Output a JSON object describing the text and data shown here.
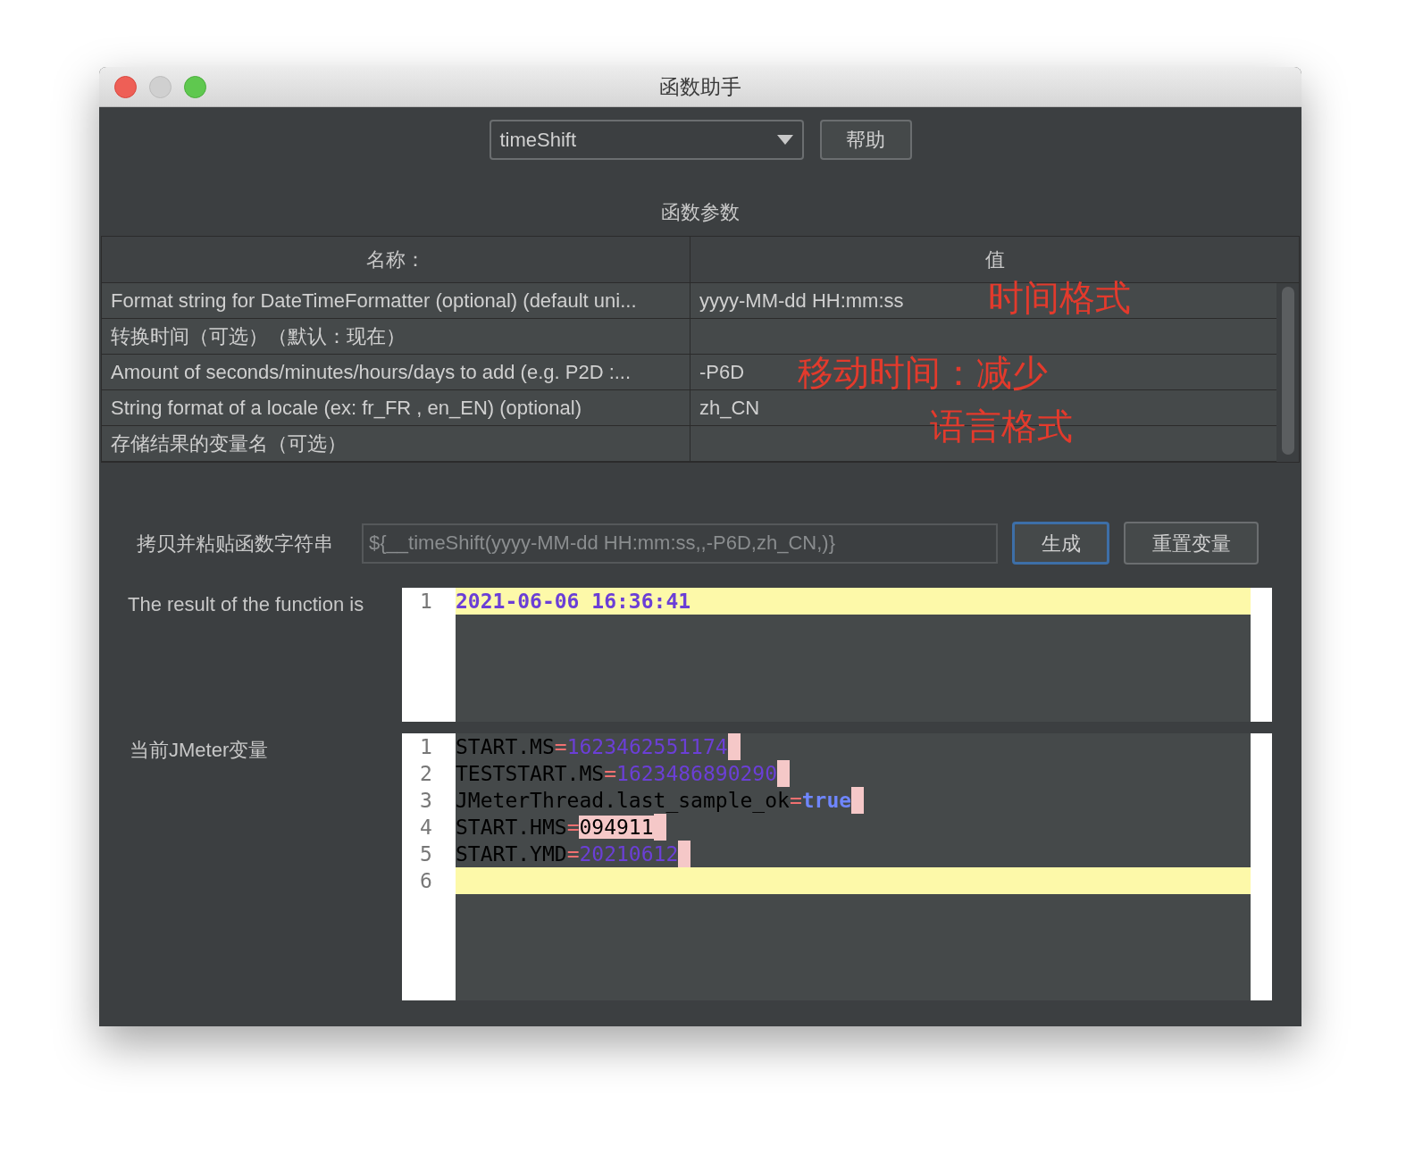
{
  "window": {
    "title": "函数助手"
  },
  "function_select": {
    "value": "timeShift"
  },
  "help_button": "帮助",
  "params_title": "函数参数",
  "table": {
    "columns": [
      "名称：",
      "值"
    ],
    "rows": [
      {
        "name": "Format string for DateTimeFormatter (optional) (default uni...",
        "value": "yyyy-MM-dd HH:mm:ss"
      },
      {
        "name": "转换时间（可选）（默认：现在）",
        "value": ""
      },
      {
        "name": "Amount of seconds/minutes/hours/days to add (e.g. P2D :...",
        "value": "-P6D"
      },
      {
        "name": "String format of a locale (ex: fr_FR , en_EN) (optional)",
        "value": "zh_CN"
      },
      {
        "name": "存储结果的变量名（可选）",
        "value": ""
      }
    ]
  },
  "annotations": [
    "时间格式",
    "移动时间：减少",
    "语言格式"
  ],
  "copy_label": "拷贝并粘贴函数字符串",
  "function_string": "${__timeShift(yyyy-MM-dd HH:mm:ss,,-P6D,zh_CN,)}",
  "buttons": [
    {
      "label": "生成",
      "selected": true
    },
    {
      "label": "重置变量",
      "selected": false
    }
  ],
  "result": {
    "label": "The result of the function is",
    "lines": [
      {
        "number": "1",
        "text": "2021-06-06 16:36:41",
        "current": true
      }
    ]
  },
  "variables": {
    "label": "当前JMeter变量",
    "lines": [
      {
        "number": "1",
        "key": "START.MS",
        "separator": "=",
        "value": "1623462551174",
        "kind": "number",
        "current": false
      },
      {
        "number": "2",
        "key": "TESTSTART.MS",
        "separator": "=",
        "value": "1623486890290",
        "kind": "number",
        "current": false
      },
      {
        "number": "3",
        "key": "JMeterThread.last_sample_ok",
        "separator": "=",
        "value": "true",
        "kind": "boolean",
        "current": false
      },
      {
        "number": "4",
        "key": "START.HMS",
        "separator": "=",
        "value": "094911",
        "kind": "string",
        "current": false
      },
      {
        "number": "5",
        "key": "START.YMD",
        "separator": "=",
        "value": "20210612",
        "kind": "number",
        "current": false
      },
      {
        "number": "6",
        "current": true
      }
    ]
  }
}
